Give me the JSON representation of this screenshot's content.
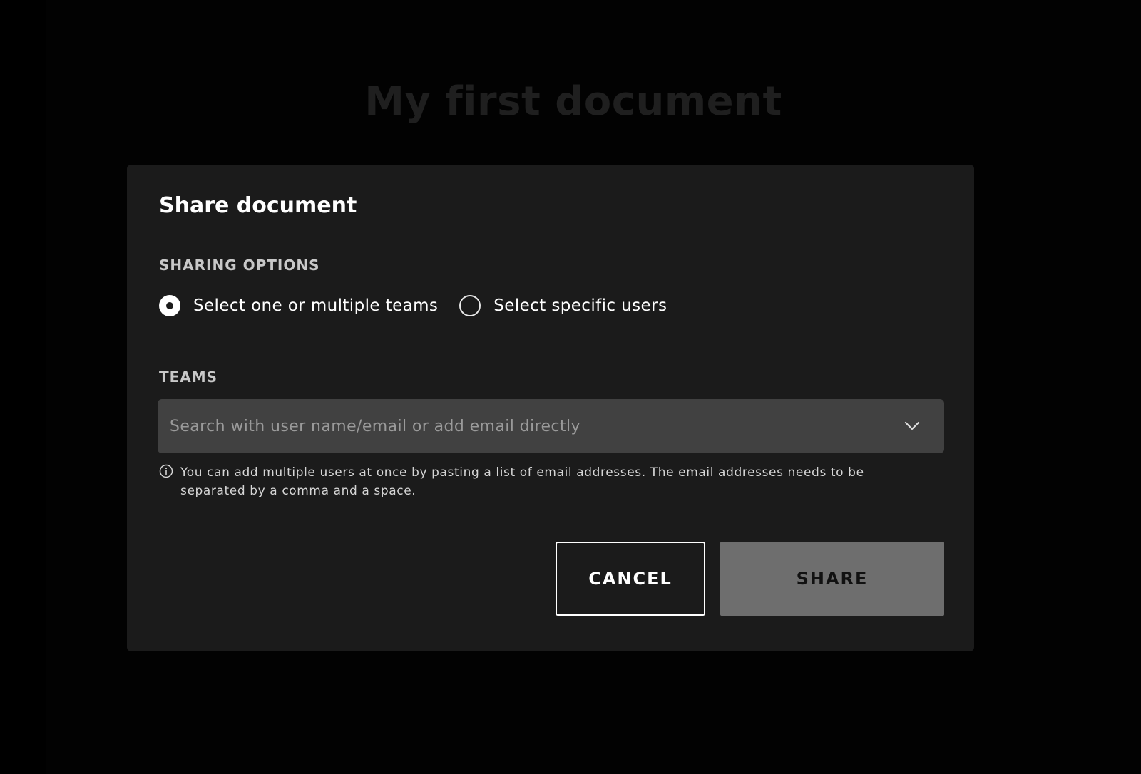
{
  "background": {
    "document_title": "My first document"
  },
  "dialog": {
    "title": "Share document",
    "sharing_options_label": "SHARING OPTIONS",
    "options": [
      {
        "label": "Select one or multiple teams",
        "selected": true
      },
      {
        "label": "Select specific users",
        "selected": false
      }
    ],
    "teams_label": "TEAMS",
    "search": {
      "value": "",
      "placeholder": "Search with user name/email or add email directly"
    },
    "hint": "You can add multiple users at once by pasting a list of email addresses. The email addresses needs to be separated by a comma and a space.",
    "cancel_label": "CANCEL",
    "share_label": "SHARE"
  },
  "icons": {
    "dropdown": "chevron-down-icon",
    "hint": "info-icon"
  },
  "colors": {
    "page_background": "#000000",
    "dialog_background": "#1b1b1b",
    "input_background": "#414141",
    "share_button_disabled": "#6e6e6e",
    "text_primary": "#ffffff"
  }
}
